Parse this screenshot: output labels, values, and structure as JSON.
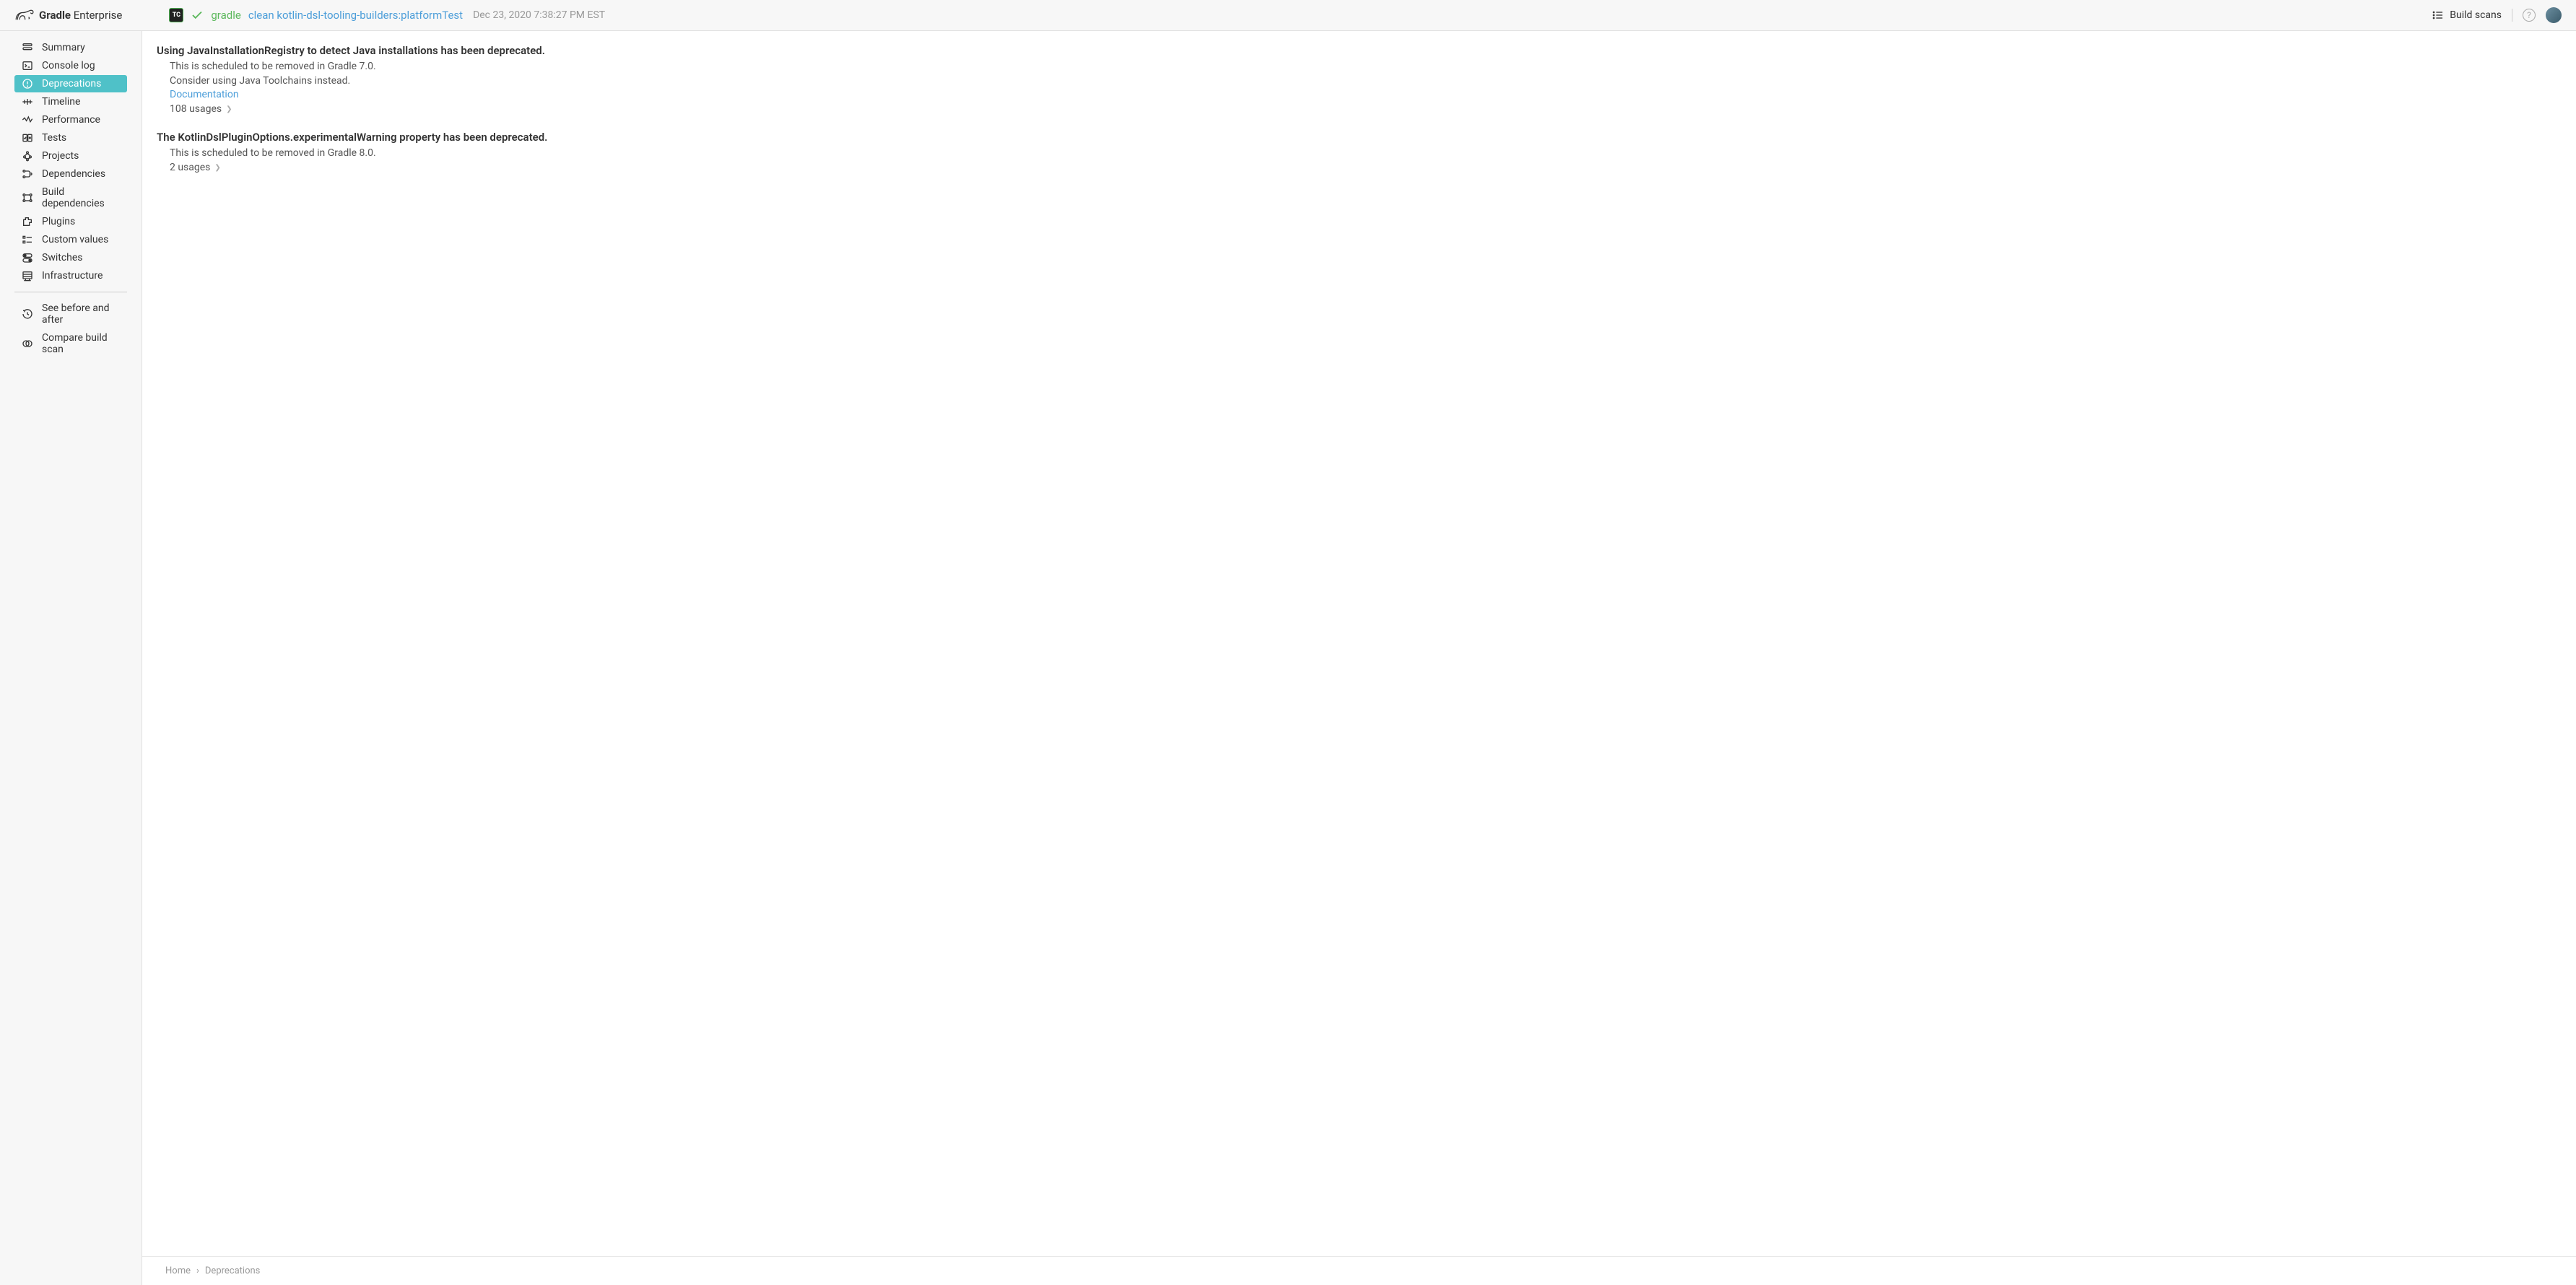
{
  "header": {
    "brand_bold": "Gradle",
    "brand_light": "Enterprise",
    "tc_badge": "TC",
    "build_tool": "gradle",
    "build_task": "clean kotlin-dsl-tooling-builders:platformTest",
    "build_time": "Dec 23, 2020 7:38:27 PM EST",
    "build_scans_label": "Build scans",
    "help_glyph": "?"
  },
  "sidebar": {
    "items": [
      {
        "label": "Summary"
      },
      {
        "label": "Console log"
      },
      {
        "label": "Deprecations"
      },
      {
        "label": "Timeline"
      },
      {
        "label": "Performance"
      },
      {
        "label": "Tests"
      },
      {
        "label": "Projects"
      },
      {
        "label": "Dependencies"
      },
      {
        "label": "Build dependencies"
      },
      {
        "label": "Plugins"
      },
      {
        "label": "Custom values"
      },
      {
        "label": "Switches"
      },
      {
        "label": "Infrastructure"
      }
    ],
    "actions": [
      {
        "label": "See before and after"
      },
      {
        "label": "Compare build scan"
      }
    ]
  },
  "deprecations": [
    {
      "title": "Using JavaInstallationRegistry to detect Java installations has been deprecated.",
      "detail1": "This is scheduled to be removed in Gradle 7.0.",
      "detail2": "Consider using Java Toolchains instead.",
      "doc_link": "Documentation",
      "usages": "108 usages"
    },
    {
      "title": "The KotlinDslPluginOptions.experimentalWarning property has been deprecated.",
      "detail1": "This is scheduled to be removed in Gradle 8.0.",
      "usages": "2 usages"
    }
  ],
  "breadcrumb": {
    "home": "Home",
    "sep": "›",
    "current": "Deprecations"
  }
}
